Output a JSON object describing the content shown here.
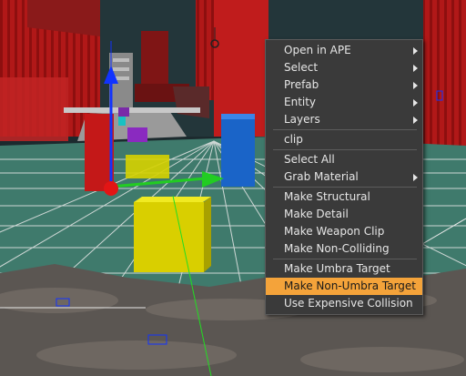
{
  "context_menu": {
    "items": [
      {
        "label": "Open in APE",
        "submenu": true
      },
      {
        "label": "Select",
        "submenu": true
      },
      {
        "label": "Prefab",
        "submenu": true
      },
      {
        "label": "Entity",
        "submenu": true
      },
      {
        "label": "Layers",
        "submenu": true
      },
      {
        "separator": true
      },
      {
        "label": "clip",
        "submenu": false
      },
      {
        "separator": true
      },
      {
        "label": "Select All",
        "submenu": false
      },
      {
        "label": "Grab Material",
        "submenu": true
      },
      {
        "separator": true
      },
      {
        "label": "Make Structural",
        "submenu": false
      },
      {
        "label": "Make Detail",
        "submenu": false
      },
      {
        "label": "Make Weapon Clip",
        "submenu": false
      },
      {
        "label": "Make Non-Colliding",
        "submenu": false
      },
      {
        "separator": true
      },
      {
        "label": "Make Umbra Target",
        "submenu": false
      },
      {
        "label": "Make Non-Umbra Target",
        "submenu": false,
        "highlighted": true
      },
      {
        "label": "Use Expensive Collision",
        "submenu": false
      }
    ]
  },
  "colors": {
    "menu_highlight": "#f4a33a",
    "gizmo_y": "#1133ff",
    "gizmo_x": "#22cc22",
    "selection": "#e8e000",
    "grid": "#e8e8e8"
  }
}
